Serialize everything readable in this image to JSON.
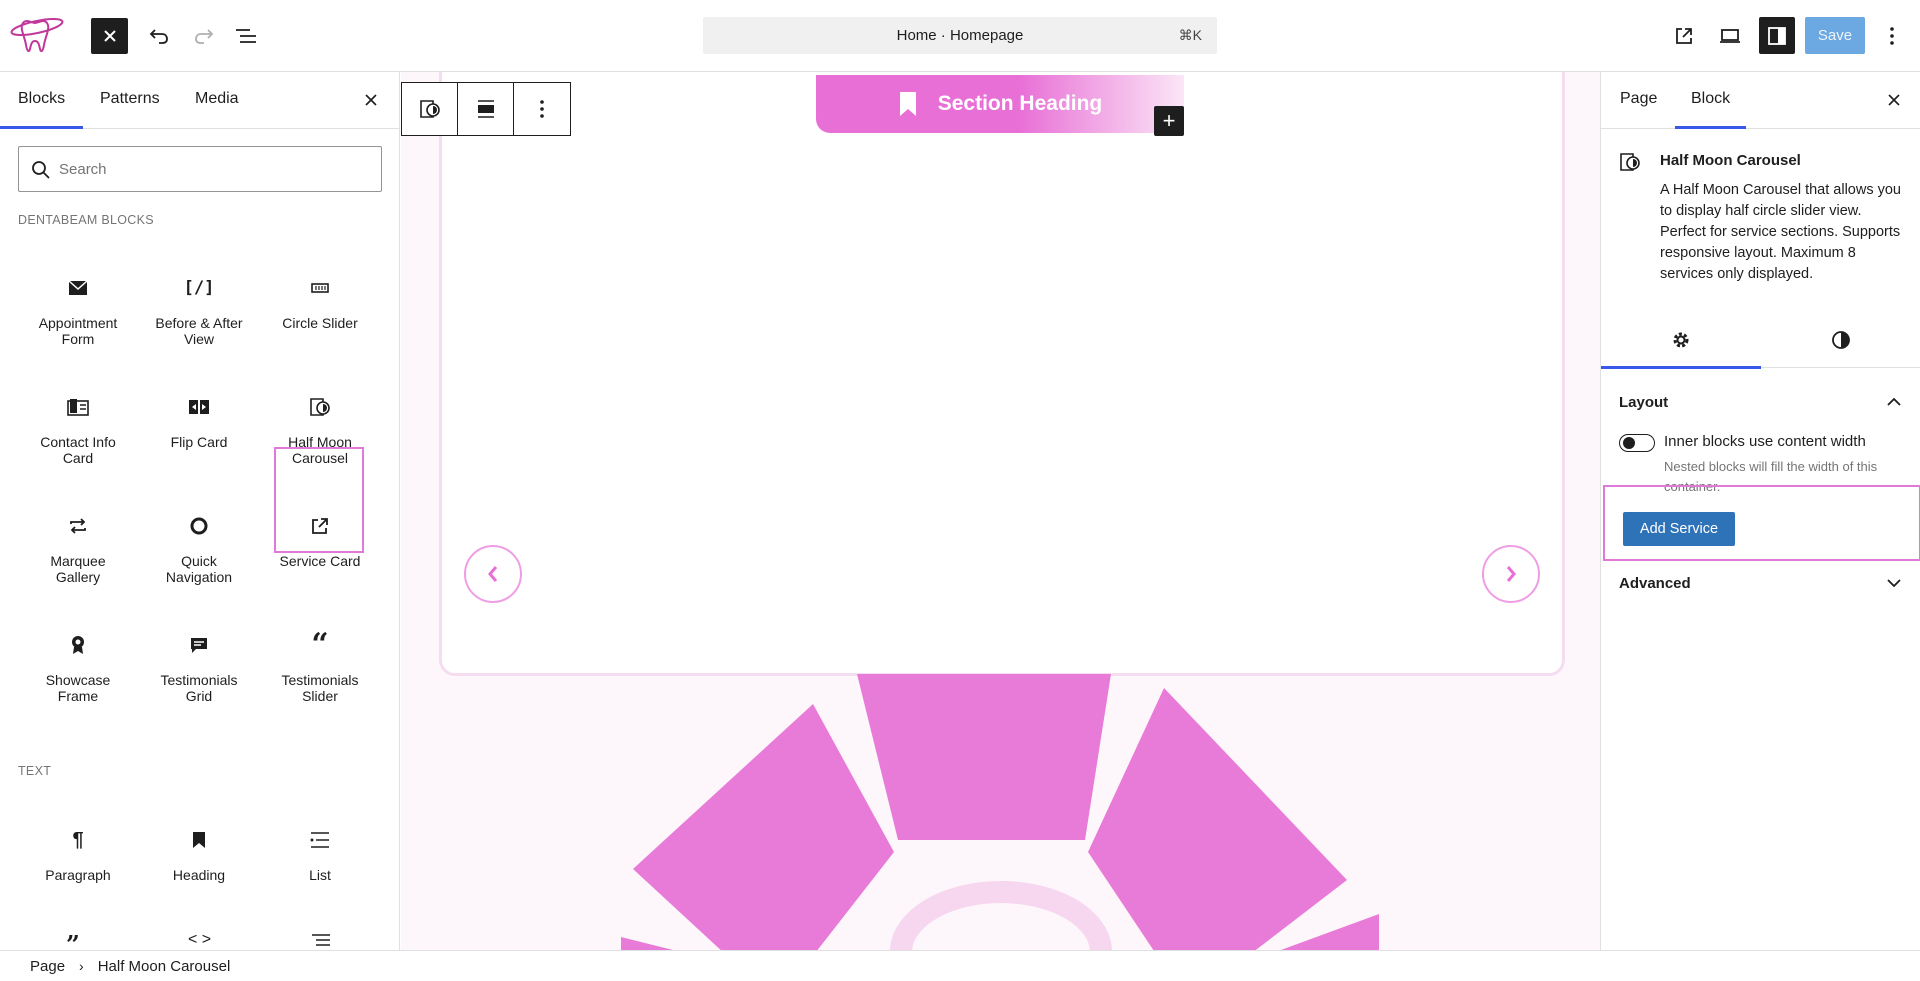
{
  "topbar": {
    "command_text": "Home · Homepage",
    "command_shortcut": "⌘K",
    "save_label": "Save"
  },
  "inserter": {
    "tabs": [
      "Blocks",
      "Patterns",
      "Media"
    ],
    "search_placeholder": "Search",
    "categories": {
      "dentabeam": "DENTABEAM BLOCKS",
      "text": "TEXT"
    },
    "dentabeam_blocks": [
      {
        "label": "Appointment Form",
        "icon": "mail-icon"
      },
      {
        "label": "Before & After View",
        "icon": "shortcode-icon"
      },
      {
        "label": "Circle Slider",
        "icon": "slider-icon"
      },
      {
        "label": "Contact Info Card",
        "icon": "contact-card-icon"
      },
      {
        "label": "Flip Card",
        "icon": "flip-icon"
      },
      {
        "label": "Half Moon Carousel",
        "icon": "half-moon-icon"
      },
      {
        "label": "Marquee Gallery",
        "icon": "repeat-icon"
      },
      {
        "label": "Quick Navigation",
        "icon": "circle-icon"
      },
      {
        "label": "Service Card",
        "icon": "external-icon"
      },
      {
        "label": "Showcase Frame",
        "icon": "award-icon"
      },
      {
        "label": "Testimonials Grid",
        "icon": "comment-icon"
      },
      {
        "label": "Testimonials Slider",
        "icon": "quote-icon"
      }
    ],
    "text_blocks": [
      {
        "label": "Paragraph",
        "icon": "paragraph-icon"
      },
      {
        "label": "Heading",
        "icon": "bookmark-icon"
      },
      {
        "label": "List",
        "icon": "list-icon"
      }
    ]
  },
  "canvas": {
    "section_heading": "Section Heading",
    "accent_color": "#e86fd6"
  },
  "settings": {
    "tabs": [
      "Page",
      "Block"
    ],
    "block_title": "Half Moon Carousel",
    "block_description": "A Half Moon Carousel that allows you to display half circle slider view. Perfect for service sections. Supports responsive layout. Maximum 8 services only displayed.",
    "layout_title": "Layout",
    "toggle_label": "Inner blocks use content width",
    "toggle_help": "Nested blocks will fill the width of this container.",
    "add_service_label": "Add Service",
    "advanced_title": "Advanced"
  },
  "breadcrumb": [
    "Page",
    "Half Moon Carousel"
  ]
}
